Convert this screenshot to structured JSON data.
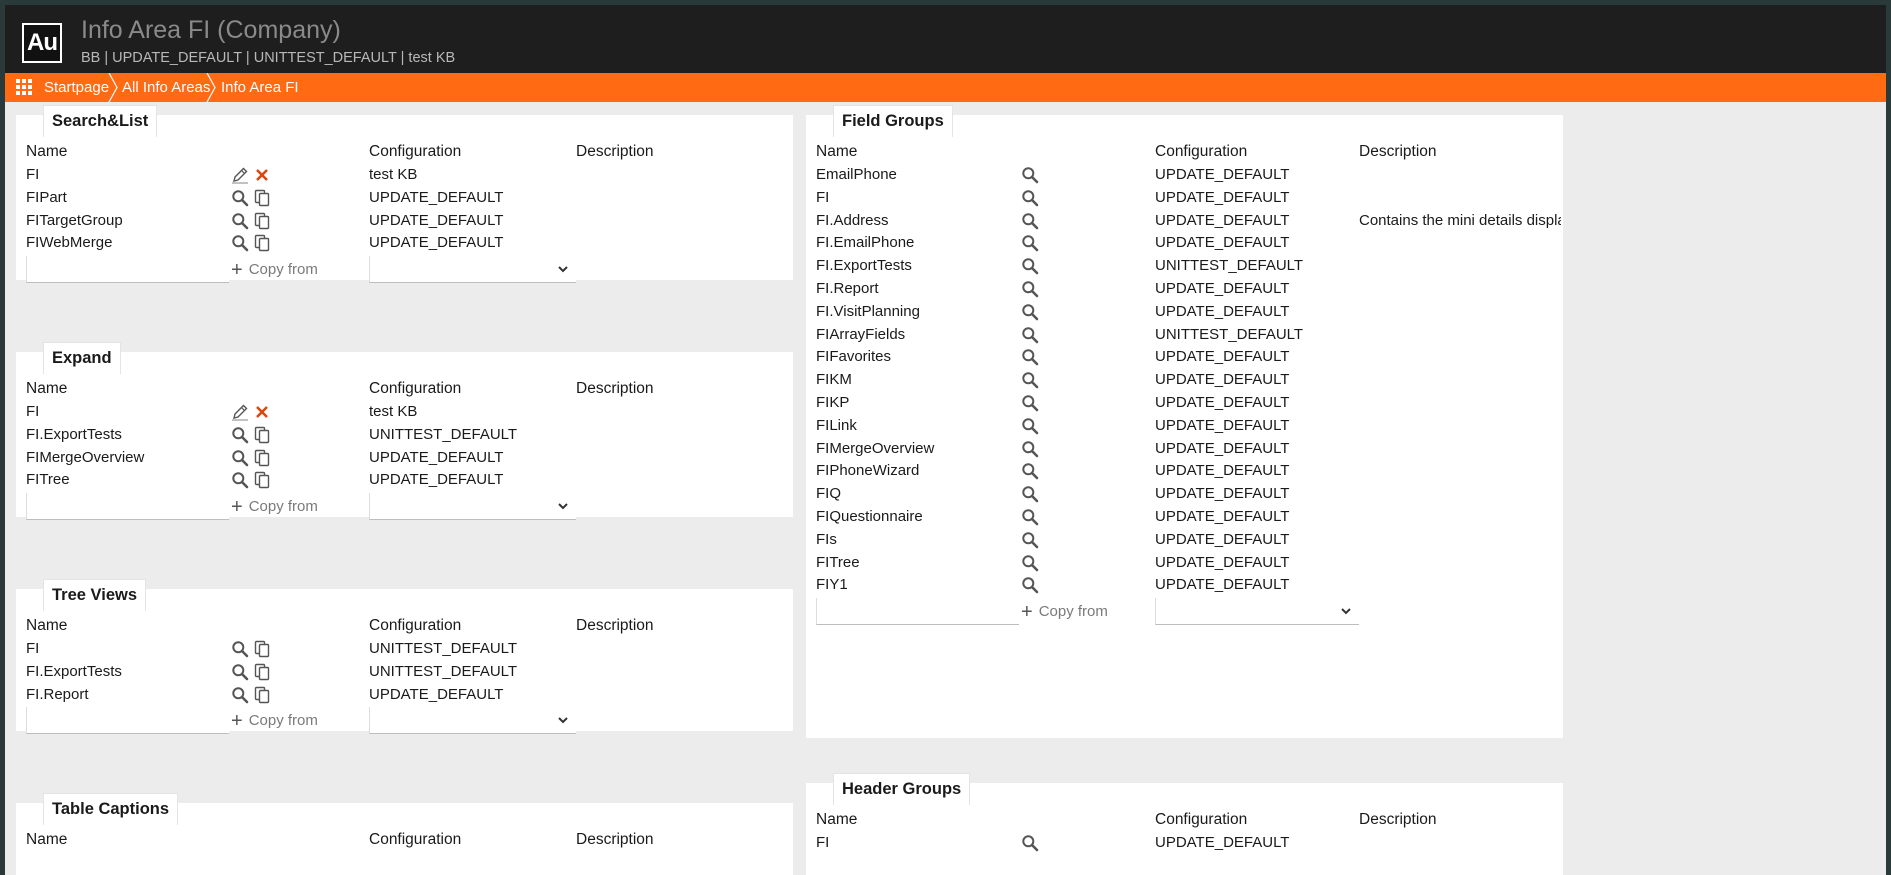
{
  "app": {
    "logo": "Au",
    "title": "Info Area FI (Company)",
    "subtitle": "BB | UPDATE_DEFAULT | UNITTEST_DEFAULT | test KB"
  },
  "breadcrumb": [
    "Startpage",
    "All Info Areas",
    "Info Area FI"
  ],
  "columns": {
    "name": "Name",
    "configuration": "Configuration",
    "description": "Description"
  },
  "copy_from_label": "Copy from",
  "left_panels": [
    {
      "title": "Search&List",
      "rows": [
        {
          "name": "FI",
          "configuration": "test KB",
          "description": "",
          "mode": "edit"
        },
        {
          "name": "FIPart",
          "configuration": "UPDATE_DEFAULT",
          "description": "",
          "mode": "view"
        },
        {
          "name": "FITargetGroup",
          "configuration": "UPDATE_DEFAULT",
          "description": "",
          "mode": "view"
        },
        {
          "name": "FIWebMerge",
          "configuration": "UPDATE_DEFAULT",
          "description": "",
          "mode": "view"
        }
      ]
    },
    {
      "title": "Expand",
      "rows": [
        {
          "name": "FI",
          "configuration": "test KB",
          "description": "",
          "mode": "edit"
        },
        {
          "name": "FI.ExportTests",
          "configuration": "UNITTEST_DEFAULT",
          "description": "",
          "mode": "view"
        },
        {
          "name": "FIMergeOverview",
          "configuration": "UPDATE_DEFAULT",
          "description": "",
          "mode": "view"
        },
        {
          "name": "FITree",
          "configuration": "UPDATE_DEFAULT",
          "description": "",
          "mode": "view"
        }
      ]
    },
    {
      "title": "Tree Views",
      "rows": [
        {
          "name": "FI",
          "configuration": "UNITTEST_DEFAULT",
          "description": "",
          "mode": "view"
        },
        {
          "name": "FI.ExportTests",
          "configuration": "UNITTEST_DEFAULT",
          "description": "",
          "mode": "view"
        },
        {
          "name": "FI.Report",
          "configuration": "UPDATE_DEFAULT",
          "description": "",
          "mode": "view"
        }
      ]
    },
    {
      "title": "Table Captions",
      "rows": []
    }
  ],
  "right_panels": [
    {
      "title": "Field Groups",
      "rows": [
        {
          "name": "EmailPhone",
          "configuration": "UPDATE_DEFAULT",
          "description": ""
        },
        {
          "name": "FI",
          "configuration": "UPDATE_DEFAULT",
          "description": ""
        },
        {
          "name": "FI.Address",
          "configuration": "UPDATE_DEFAULT",
          "description": "Contains the mini details displaye..."
        },
        {
          "name": "FI.EmailPhone",
          "configuration": "UPDATE_DEFAULT",
          "description": ""
        },
        {
          "name": "FI.ExportTests",
          "configuration": "UNITTEST_DEFAULT",
          "description": ""
        },
        {
          "name": "FI.Report",
          "configuration": "UPDATE_DEFAULT",
          "description": ""
        },
        {
          "name": "FI.VisitPlanning",
          "configuration": "UPDATE_DEFAULT",
          "description": ""
        },
        {
          "name": "FIArrayFields",
          "configuration": "UNITTEST_DEFAULT",
          "description": ""
        },
        {
          "name": "FIFavorites",
          "configuration": "UPDATE_DEFAULT",
          "description": ""
        },
        {
          "name": "FIKM",
          "configuration": "UPDATE_DEFAULT",
          "description": ""
        },
        {
          "name": "FIKP",
          "configuration": "UPDATE_DEFAULT",
          "description": ""
        },
        {
          "name": "FILink",
          "configuration": "UPDATE_DEFAULT",
          "description": ""
        },
        {
          "name": "FIMergeOverview",
          "configuration": "UPDATE_DEFAULT",
          "description": ""
        },
        {
          "name": "FIPhoneWizard",
          "configuration": "UPDATE_DEFAULT",
          "description": ""
        },
        {
          "name": "FIQ",
          "configuration": "UPDATE_DEFAULT",
          "description": ""
        },
        {
          "name": "FIQuestionnaire",
          "configuration": "UPDATE_DEFAULT",
          "description": ""
        },
        {
          "name": "FIs",
          "configuration": "UPDATE_DEFAULT",
          "description": ""
        },
        {
          "name": "FITree",
          "configuration": "UPDATE_DEFAULT",
          "description": ""
        },
        {
          "name": "FIY1",
          "configuration": "UPDATE_DEFAULT",
          "description": ""
        }
      ]
    },
    {
      "title": "Header Groups",
      "rows": [
        {
          "name": "FI",
          "configuration": "UPDATE_DEFAULT",
          "description": ""
        }
      ]
    }
  ],
  "colors": {
    "accent": "#ff6a13",
    "topbar": "#1e1e1e",
    "delete": "#d9480f"
  },
  "icons": {
    "edit": "pencil-icon",
    "delete": "close-icon",
    "view": "search-icon",
    "copy": "copy-icon",
    "add": "plus-icon",
    "dropdown": "chevron-down-icon",
    "apps": "grid-icon"
  }
}
